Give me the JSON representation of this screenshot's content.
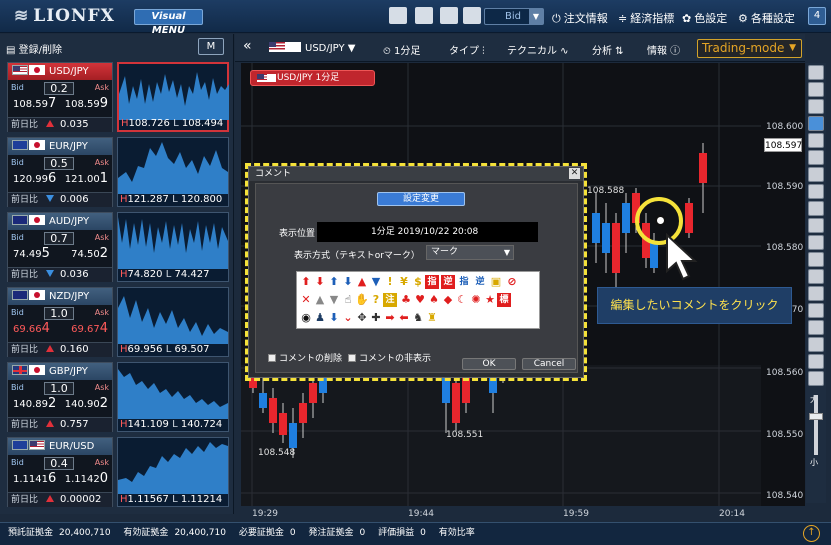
{
  "header": {
    "logo_text": "LIONFX",
    "visual_menu_label": "Visual MENU",
    "price_type": "Bid",
    "links": {
      "orders": "注文情報",
      "economic": "経済指標",
      "color": "色設定",
      "settings": "各種設定"
    },
    "help_label": "4"
  },
  "left": {
    "register_label": "登録/削除",
    "m_button": "M",
    "change_label": "前日比",
    "pairs": [
      {
        "name": "USD/JPY",
        "spread": "0.2",
        "bid_a": "108.59",
        "bid_b": "7",
        "ask_a": "108.59",
        "ask_b": "9",
        "dir": "up",
        "change": "0.035",
        "high": "108.726",
        "low": "108.494"
      },
      {
        "name": "EUR/JPY",
        "spread": "0.5",
        "bid_a": "120.99",
        "bid_b": "6",
        "ask_a": "121.00",
        "ask_b": "1",
        "dir": "down",
        "change": "0.006",
        "high": "121.287",
        "low": "120.800"
      },
      {
        "name": "AUD/JPY",
        "spread": "0.7",
        "bid_a": "74.49",
        "bid_b": "5",
        "ask_a": "74.50",
        "ask_b": "2",
        "dir": "down",
        "change": "0.036",
        "high": "74.820",
        "low": "74.427"
      },
      {
        "name": "NZD/JPY",
        "spread": "1.0",
        "bid_a": "69.66",
        "bid_b": "4",
        "ask_a": "69.67",
        "ask_b": "4",
        "dir": "up",
        "change": "0.160",
        "high": "69.956",
        "low": "69.507"
      },
      {
        "name": "GBP/JPY",
        "spread": "1.0",
        "bid_a": "140.89",
        "bid_b": "2",
        "ask_a": "140.90",
        "ask_b": "2",
        "dir": "up",
        "change": "0.757",
        "high": "141.109",
        "low": "140.724"
      },
      {
        "name": "EUR/USD",
        "spread": "0.4",
        "bid_a": "1.1141",
        "bid_b": "6",
        "ask_a": "1.1142",
        "ask_b": "0",
        "dir": "up",
        "change": "0.00002",
        "high": "1.11567",
        "low": "1.11214"
      }
    ]
  },
  "toolbar": {
    "pair": "USD/JPY",
    "timeframe": "1分足",
    "type": "タイプ",
    "technical": "テクニカル",
    "analysis": "分析",
    "info": "情報",
    "trading_mode": "Trading-mode"
  },
  "chart": {
    "label": "USD/JPY 1分足",
    "current_price": "108.597",
    "y_ticks": [
      "108.600",
      "108.590",
      "108.580",
      "108.570",
      "108.560",
      "108.550",
      "108.540"
    ],
    "x_ticks": [
      "19:29",
      "19:44",
      "19:59",
      "20:14"
    ],
    "annot_high": "108.588",
    "annot_low1": "108.551",
    "annot_low2": "108.548",
    "colors": {
      "up": "#e8262d",
      "down": "#1f7fe0",
      "bg": "#0f1115"
    }
  },
  "dialog": {
    "title": "コメント",
    "settings_button": "設定変更",
    "position_label": "表示位置",
    "position_value": "1分足  2019/10/22  20:08",
    "mode_label": "表示方式（テキストorマーク）",
    "mode_value": "マーク",
    "marks_row3_text": [
      "注",
      "標",
      "指",
      "逆",
      "指",
      "逆"
    ],
    "delete_label": "コメントの削除",
    "hide_label": "コメントの非表示",
    "ok_label": "OK",
    "cancel_label": "Cancel"
  },
  "callout": "編集したいコメントをクリック",
  "footer": {
    "items": [
      {
        "label": "預託証拠金",
        "value": "20,400,710"
      },
      {
        "label": "有効証拠金",
        "value": "20,400,710"
      },
      {
        "label": "必要証拠金",
        "value": "0"
      },
      {
        "label": "発注証拠金",
        "value": "0"
      },
      {
        "label": "評価損益",
        "value": "0"
      },
      {
        "label": "有効比率",
        "value": ""
      }
    ]
  }
}
